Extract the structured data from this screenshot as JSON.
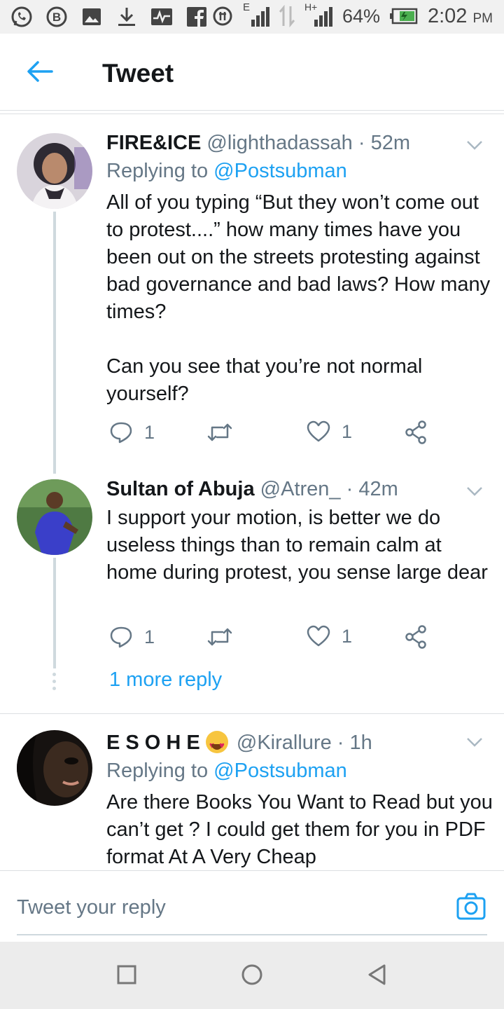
{
  "status_bar": {
    "left_icons": [
      "whatsapp-icon",
      "b-badge-icon",
      "image-icon",
      "download-icon",
      "activity-icon",
      "facebook-icon"
    ],
    "network_label": "E",
    "network_label_2": "H+",
    "battery_percent": "64%",
    "time": "2:02",
    "ampm": "PM"
  },
  "header": {
    "title": "Tweet"
  },
  "tweets": [
    {
      "name": "FIRE&ICE",
      "handle": "@lighthadassah",
      "time": "· 52m",
      "replying_label": "Replying to",
      "replying_to": "@Postsubman",
      "text": "All of you typing “But they won’t come out to protest....” how many times have you been out on the streets protesting against bad governance and bad laws? How many times?\n\nCan you see that you’re not normal yourself?",
      "replies": "1",
      "likes": "1",
      "avatar_color": "#2e2a33"
    },
    {
      "name": "Sultan of Abuja",
      "handle": "@Atren_",
      "time": "· 42m",
      "text": "I support your motion, is better we do useless things than to remain calm at home during protest, you sense large dear",
      "replies": "1",
      "likes": "1",
      "avatar_color": "#3c6a3a"
    },
    {
      "name": "E S O H E",
      "handle": "@Kirallure",
      "time": "· 1h",
      "replying_label": "Replying to",
      "replying_to": "@Postsubman",
      "text": "Are there Books You Want to Read but you can’t get ? I could get them for you in PDF format At A Very Cheap",
      "avatar_color": "#3b2a1f"
    }
  ],
  "more_reply": "1 more reply",
  "reply_bar": {
    "placeholder": "Tweet your reply"
  },
  "colors": {
    "accent": "#1da1f2",
    "text": "#14171a",
    "muted": "#657786",
    "divider": "#dcdfe2"
  }
}
